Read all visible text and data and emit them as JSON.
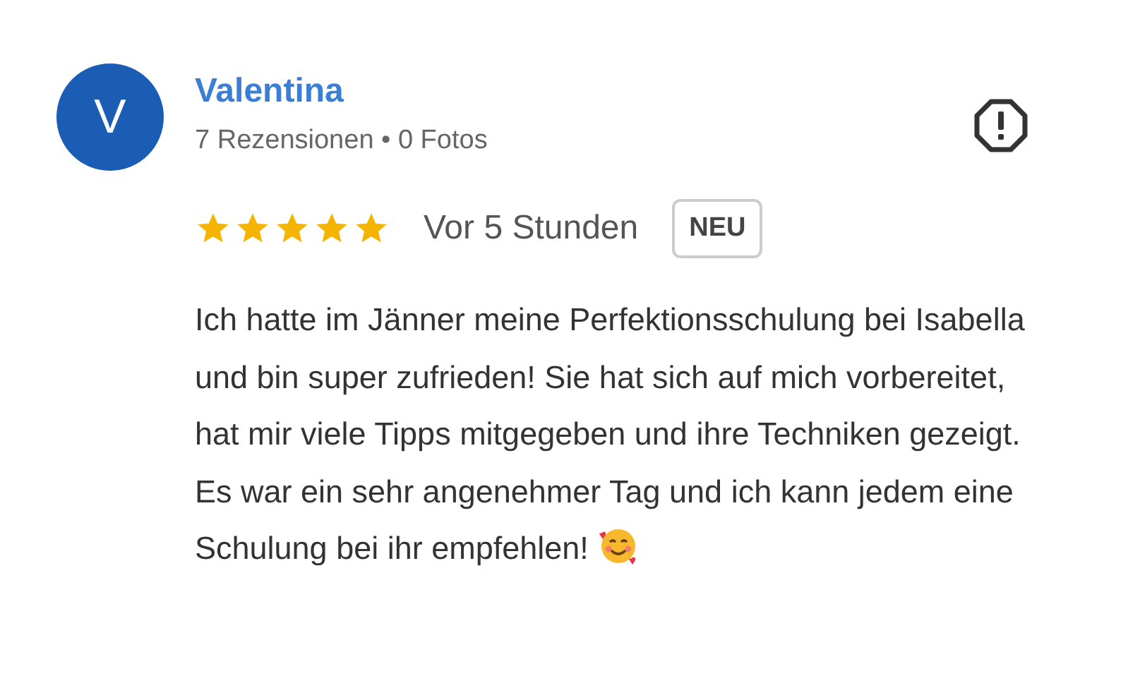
{
  "review": {
    "avatar_letter": "V",
    "author": "Valentina",
    "meta": "7 Rezensionen • 0 Fotos",
    "stars": 5,
    "time": "Vor 5 Stunden",
    "badge": "NEU",
    "text": "Ich hatte im Jänner meine Perfektionsschulung bei Isabella und bin super zufrieden! Sie hat sich auf mich vorbereitet, hat mir viele Tipps mitgegeben und ihre Techniken gezeigt. Es war ein sehr angenehmer Tag und ich kann jedem eine Schulung bei ihr empfehlen!"
  }
}
